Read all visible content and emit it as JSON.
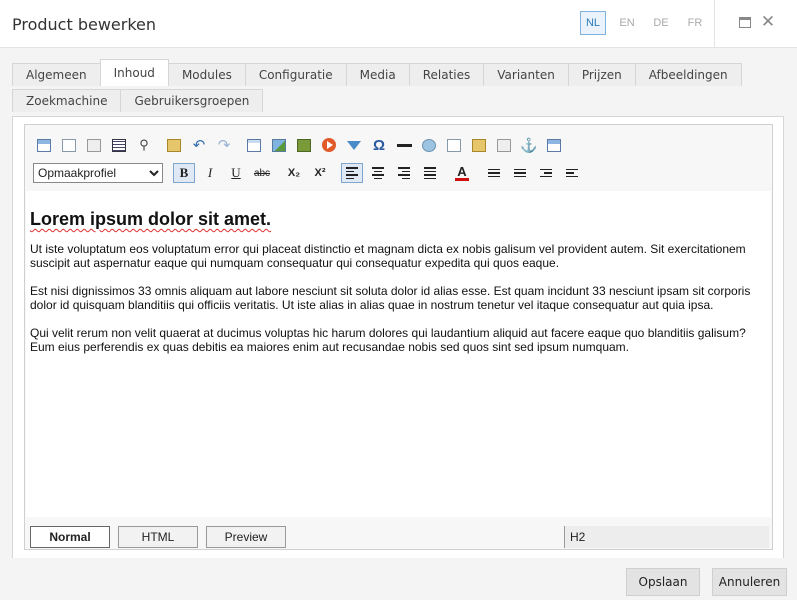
{
  "window": {
    "title": "Product bewerken",
    "languages": [
      {
        "code": "NL",
        "active": true
      },
      {
        "code": "EN",
        "active": false
      },
      {
        "code": "DE",
        "active": false
      },
      {
        "code": "FR",
        "active": false
      }
    ],
    "close_glyph": "✕"
  },
  "tabs": {
    "row1": [
      "Algemeen",
      "Inhoud",
      "Modules",
      "Configuratie",
      "Media",
      "Relaties",
      "Varianten",
      "Prijzen",
      "Afbeeldingen"
    ],
    "row2": [
      "Zoekmachine",
      "Gebruikersgroepen"
    ],
    "active": "Inhoud"
  },
  "editor": {
    "format_select": {
      "value": "Opmaakprofiel",
      "options": [
        "Opmaakprofiel"
      ]
    },
    "toolbar_icons": [
      "source-icon",
      "templates-icon",
      "spellcheck-icon",
      "select-all-icon",
      "find-icon",
      "paste-icon",
      "undo-icon",
      "redo-icon",
      "table-icon",
      "image-icon",
      "media-icon",
      "video-icon",
      "filter-icon",
      "special-char-icon",
      "horizontal-rule-icon",
      "link-icon",
      "new-page-icon",
      "copy-icon",
      "letter-icon",
      "anchor-icon",
      "window-icon"
    ],
    "glyphs": {
      "bold": "B",
      "italic": "I",
      "underline": "U",
      "strike": "abc",
      "subscript": "X₂",
      "superscript": "X²",
      "undo": "↶",
      "redo": "↷",
      "omega": "Ω",
      "anchor": "⚓",
      "find": "⚲",
      "font_color": "A"
    },
    "content": {
      "heading": "Lorem ipsum dolor sit amet.",
      "paragraphs": [
        "Ut iste voluptatum eos voluptatum error qui placeat distinctio et magnam dicta ex nobis galisum vel provident autem. Sit exercitationem suscipit aut aspernatur eaque qui numquam consequatur qui consequatur expedita qui quos eaque.",
        "Est nisi dignissimos 33 omnis aliquam aut labore nesciunt sit soluta dolor id alias esse. Est quam incidunt 33 nesciunt ipsam sit corporis dolor id quisquam blanditiis qui officiis veritatis. Ut iste alias in alias quae in nostrum tenetur vel itaque consequatur aut quia ipsa.",
        "Qui velit rerum non velit quaerat at ducimus voluptas hic harum dolores qui laudantium aliquid aut facere eaque quo blanditiis galisum? Eum eius perferendis ex quas debitis ea maiores enim aut recusandae nobis sed quos sint sed ipsum numquam."
      ]
    },
    "modes": [
      "Normal",
      "HTML",
      "Preview"
    ],
    "active_mode": "Normal",
    "status": "H2"
  },
  "footer": {
    "save_label": "Opslaan",
    "cancel_label": "Annuleren"
  },
  "colors": {
    "accent": "#2a7ab8",
    "spell_underline": "#e03030",
    "font_color": "#d01010"
  }
}
